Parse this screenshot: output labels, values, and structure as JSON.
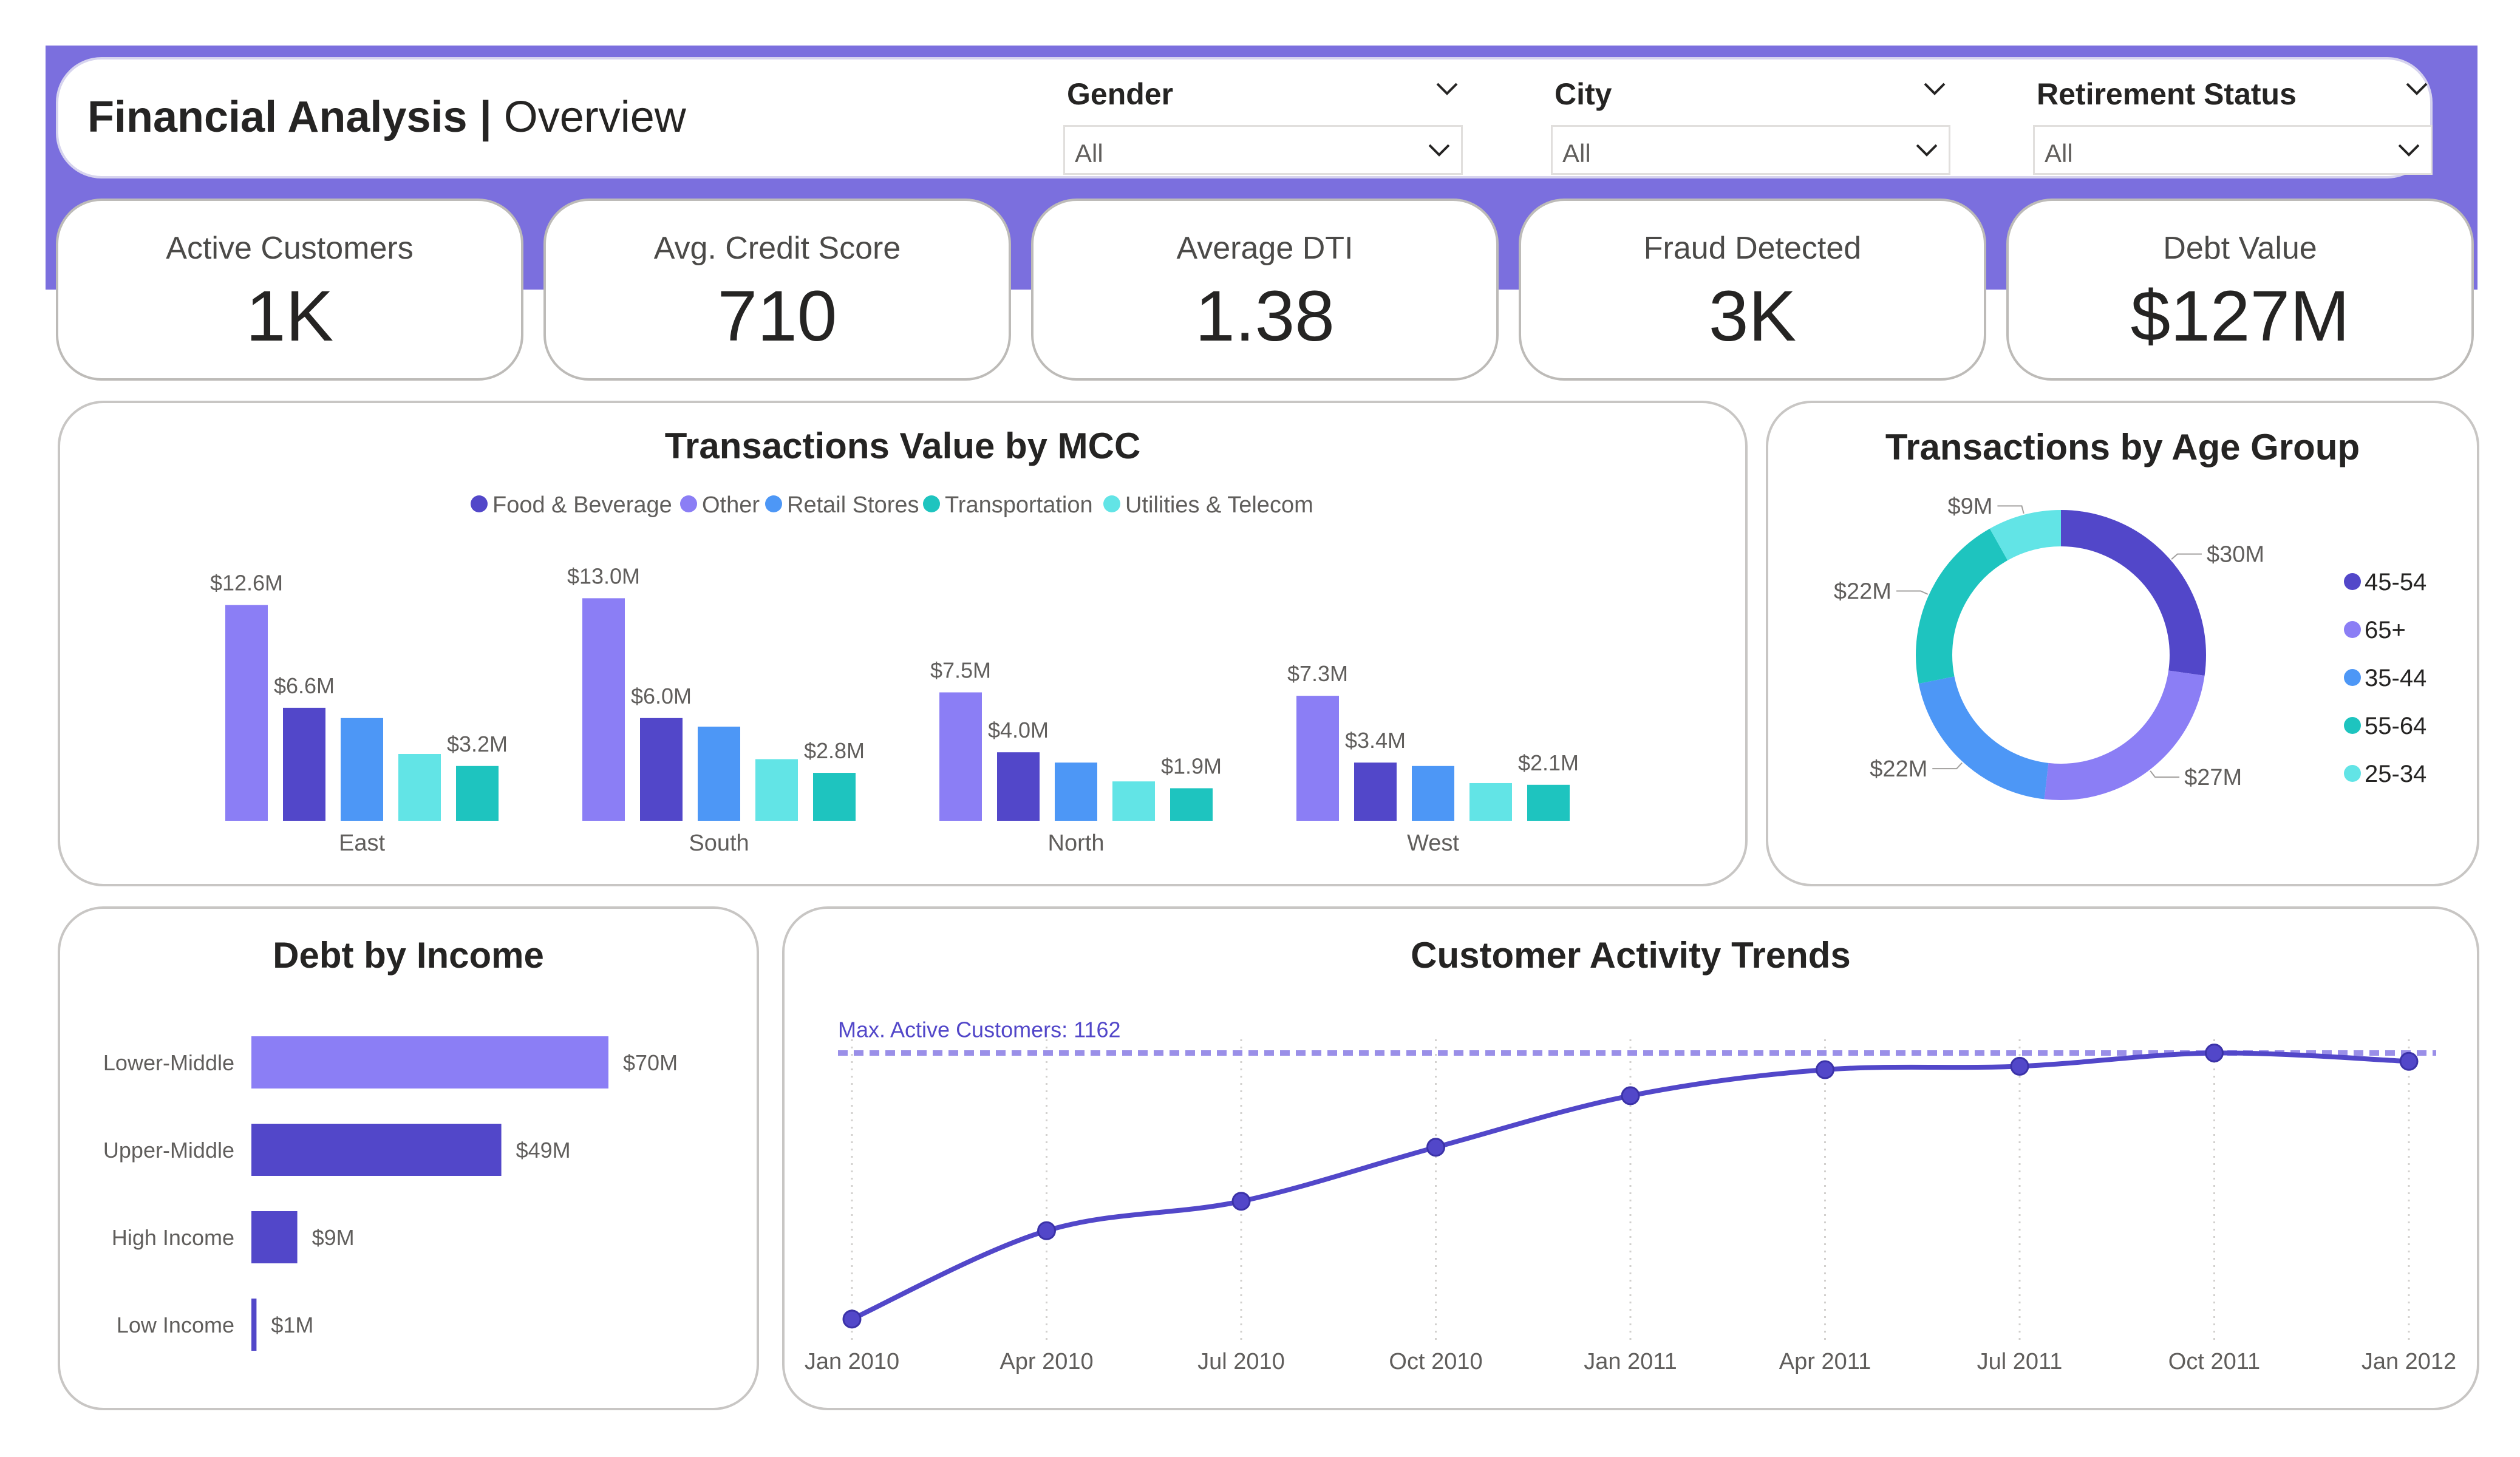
{
  "header": {
    "title_bold": "Financial Analysis |",
    "title_sub": "Overview"
  },
  "slicers": [
    {
      "label": "Gender",
      "value": "All"
    },
    {
      "label": "City",
      "value": "All"
    },
    {
      "label": "Retirement Status",
      "value": "All"
    }
  ],
  "kpis": [
    {
      "label": "Active Customers",
      "value": "1K"
    },
    {
      "label": "Avg. Credit Score",
      "value": "710"
    },
    {
      "label": "Average DTI",
      "value": "1.38"
    },
    {
      "label": "Fraud Detected",
      "value": "3K"
    },
    {
      "label": "Debt Value",
      "value": "$127M"
    }
  ],
  "colors": {
    "accent": "#7b6fde",
    "food_beverage": "#5247c9",
    "other": "#8b7ef5",
    "retail": "#4d97f6",
    "transportation": "#1ec4bf",
    "utilities": "#62e4e6",
    "card_border": "#c8c6c4"
  },
  "panels": {
    "mcc_title": "Transactions Value by MCC",
    "age_title": "Transactions by Age Group",
    "income_title": "Debt by Income",
    "trend_title": "Customer Activity Trends"
  },
  "chart_data": [
    {
      "type": "bar",
      "title": "Transactions Value by MCC",
      "categories": [
        "East",
        "South",
        "North",
        "West"
      ],
      "legend_position": "top-center",
      "series": [
        {
          "name": "Other",
          "color": "#8b7ef5",
          "values": [
            12.6,
            13.0,
            7.5,
            7.3
          ],
          "labels": [
            "$12.6M",
            "$13.0M",
            "$7.5M",
            "$7.3M"
          ]
        },
        {
          "name": "Food & Beverage",
          "color": "#5247c9",
          "values": [
            6.6,
            6.0,
            4.0,
            3.4
          ],
          "labels": [
            "$6.6M",
            "$6.0M",
            "$4.0M",
            "$3.4M"
          ]
        },
        {
          "name": "Retail Stores",
          "color": "#4d97f6",
          "values": [
            6.0,
            5.5,
            3.4,
            3.2
          ],
          "labels": [
            "",
            "",
            "",
            ""
          ]
        },
        {
          "name": "Utilities & Telecom",
          "color": "#62e4e6",
          "values": [
            3.9,
            3.6,
            2.3,
            2.2
          ],
          "labels": [
            "",
            "",
            "",
            ""
          ]
        },
        {
          "name": "Transportation",
          "color": "#1ec4bf",
          "values": [
            3.2,
            2.8,
            1.9,
            2.1
          ],
          "labels": [
            "$3.2M",
            "$2.8M",
            "$1.9M",
            "$2.1M"
          ]
        }
      ],
      "legend": [
        {
          "name": "Food & Beverage",
          "color": "#5247c9"
        },
        {
          "name": "Other",
          "color": "#8b7ef5"
        },
        {
          "name": "Retail Stores",
          "color": "#4d97f6"
        },
        {
          "name": "Transportation",
          "color": "#1ec4bf"
        },
        {
          "name": "Utilities & Telecom",
          "color": "#62e4e6"
        }
      ]
    },
    {
      "type": "pie",
      "subtype": "donut",
      "title": "Transactions by Age Group",
      "legend_position": "right",
      "slices": [
        {
          "name": "45-54",
          "value": 30,
          "label": "$30M",
          "color": "#5247c9"
        },
        {
          "name": "65+",
          "value": 27,
          "label": "$27M",
          "color": "#8b7ef5"
        },
        {
          "name": "35-44",
          "value": 22,
          "label": "$22M",
          "color": "#4d97f6"
        },
        {
          "name": "55-64",
          "value": 22,
          "label": "$22M",
          "color": "#1ec4bf"
        },
        {
          "name": "25-34",
          "value": 9,
          "label": "$9M",
          "color": "#62e4e6"
        }
      ]
    },
    {
      "type": "bar",
      "orientation": "horizontal",
      "title": "Debt by Income",
      "categories": [
        "Lower-Middle",
        "Upper-Middle",
        "High Income",
        "Low Income"
      ],
      "values": [
        70,
        49,
        9,
        1
      ],
      "labels": [
        "$70M",
        "$49M",
        "$9M",
        "$1M"
      ],
      "colors": [
        "#8b7ef5",
        "#5247c9",
        "#5247c9",
        "#5247c9"
      ]
    },
    {
      "type": "line",
      "title": "Customer Activity Trends",
      "x": [
        "Jan 2010",
        "Apr 2010",
        "Jul 2010",
        "Oct 2010",
        "Jan 2011",
        "Apr 2011",
        "Jul 2011",
        "Oct 2011",
        "Jan 2012"
      ],
      "values": [
        620,
        800,
        860,
        970,
        1075,
        1128,
        1135,
        1162,
        1145
      ],
      "ylim": [
        600,
        1180
      ],
      "reference_line": {
        "label": "Max. Active Customers: 1162",
        "value": 1162
      },
      "color": "#5247c9",
      "grid": "vertical-dotted"
    }
  ]
}
